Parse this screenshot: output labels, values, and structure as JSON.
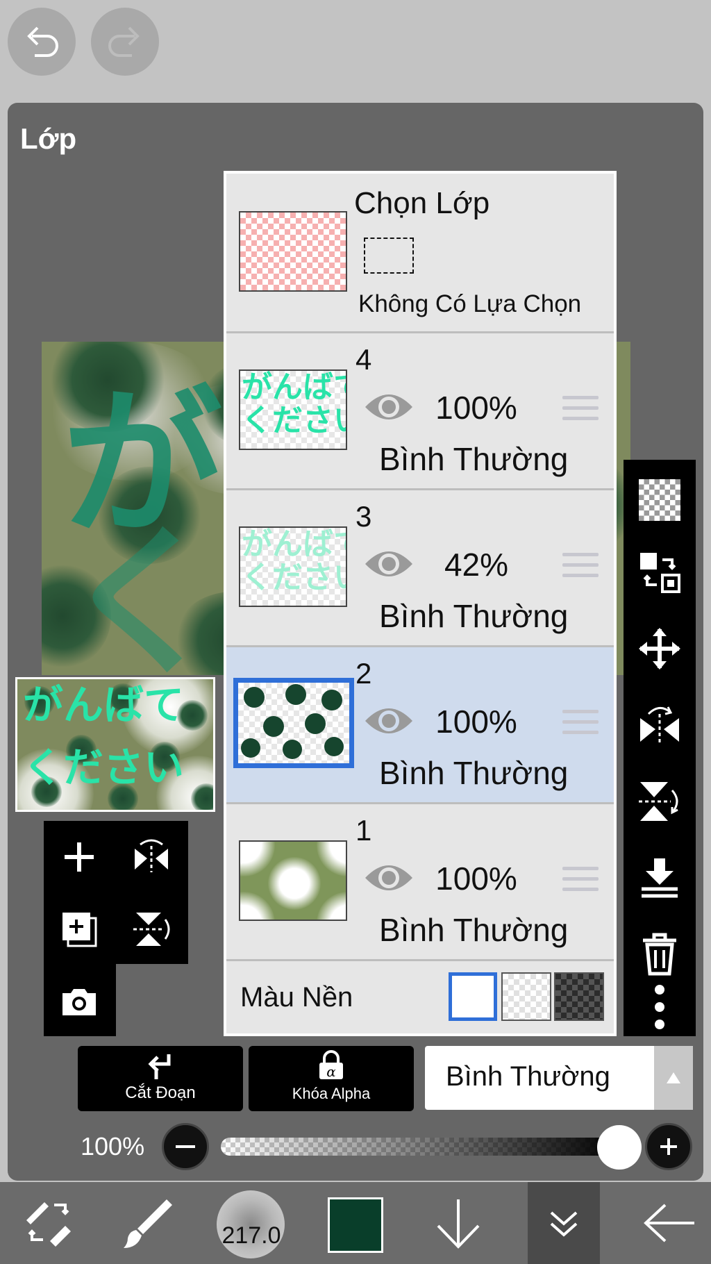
{
  "panel": {
    "title": "Lớp"
  },
  "selection_row": {
    "title": "Chọn Lớp",
    "subtitle": "Không Có Lựa Chọn"
  },
  "layers": [
    {
      "number": "4",
      "opacity": "100%",
      "blend": "Bình Thường",
      "visible": true,
      "selected": false
    },
    {
      "number": "3",
      "opacity": "42%",
      "blend": "Bình Thường",
      "visible": true,
      "selected": false
    },
    {
      "number": "2",
      "opacity": "100%",
      "blend": "Bình Thường",
      "visible": true,
      "selected": true
    },
    {
      "number": "1",
      "opacity": "100%",
      "blend": "Bình Thường",
      "visible": true,
      "selected": false
    }
  ],
  "background_row": {
    "label": "Màu Nền"
  },
  "buttons": {
    "clipping": "Cắt Đoạn",
    "alpha_lock": "Khóa Alpha"
  },
  "blend_mode": {
    "value": "Bình Thường"
  },
  "opacity_control": {
    "label": "100%",
    "value_percent": 100
  },
  "thumb_text": {
    "line1": "がんばて",
    "line2": "ください"
  },
  "bottom_bar": {
    "brush_size": "217.0",
    "color": "#093e2a"
  },
  "colors": {
    "selected_frame": "#2f6fd8",
    "selected_row": "#cfdbed",
    "canvas_text": "#29e3a8"
  }
}
